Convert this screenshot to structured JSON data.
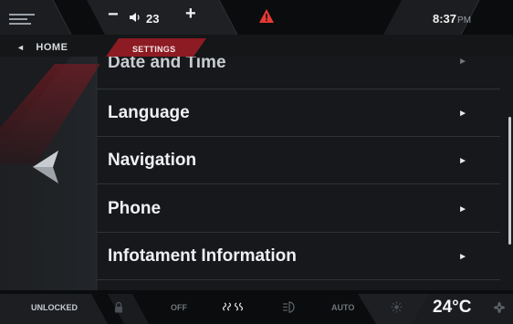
{
  "status_bar": {
    "volume_minus": "−",
    "volume_value": "23",
    "volume_plus": "+",
    "time": "8:37",
    "ampm": "PM"
  },
  "breadcrumb": {
    "home": "HOME",
    "back_arrow": "◄",
    "current": "SETTINGS"
  },
  "menu": {
    "items": [
      {
        "label": "Date and Time",
        "chevron": "►"
      },
      {
        "label": "Language",
        "chevron": "►"
      },
      {
        "label": "Navigation",
        "chevron": "►"
      },
      {
        "label": "Phone",
        "chevron": "►"
      },
      {
        "label": "Infotament Information",
        "chevron": "►"
      }
    ]
  },
  "bottom_bar": {
    "lock_status": "UNLOCKED",
    "fan_mode": "OFF",
    "climate_mode": "AUTO",
    "temperature": "24°C"
  },
  "icons": {
    "menu": "menu-icon",
    "volume": "speaker-icon",
    "warning": "warning-triangle-icon",
    "back": "back-arrow-icon",
    "lock": "lock-icon",
    "defrost": "defrost-icon",
    "headlight": "headlight-icon",
    "brightness": "sun-icon",
    "fan": "fan-icon"
  },
  "colors": {
    "accent_red": "#a3202a",
    "warning": "#e53935",
    "background": "#16181b"
  }
}
